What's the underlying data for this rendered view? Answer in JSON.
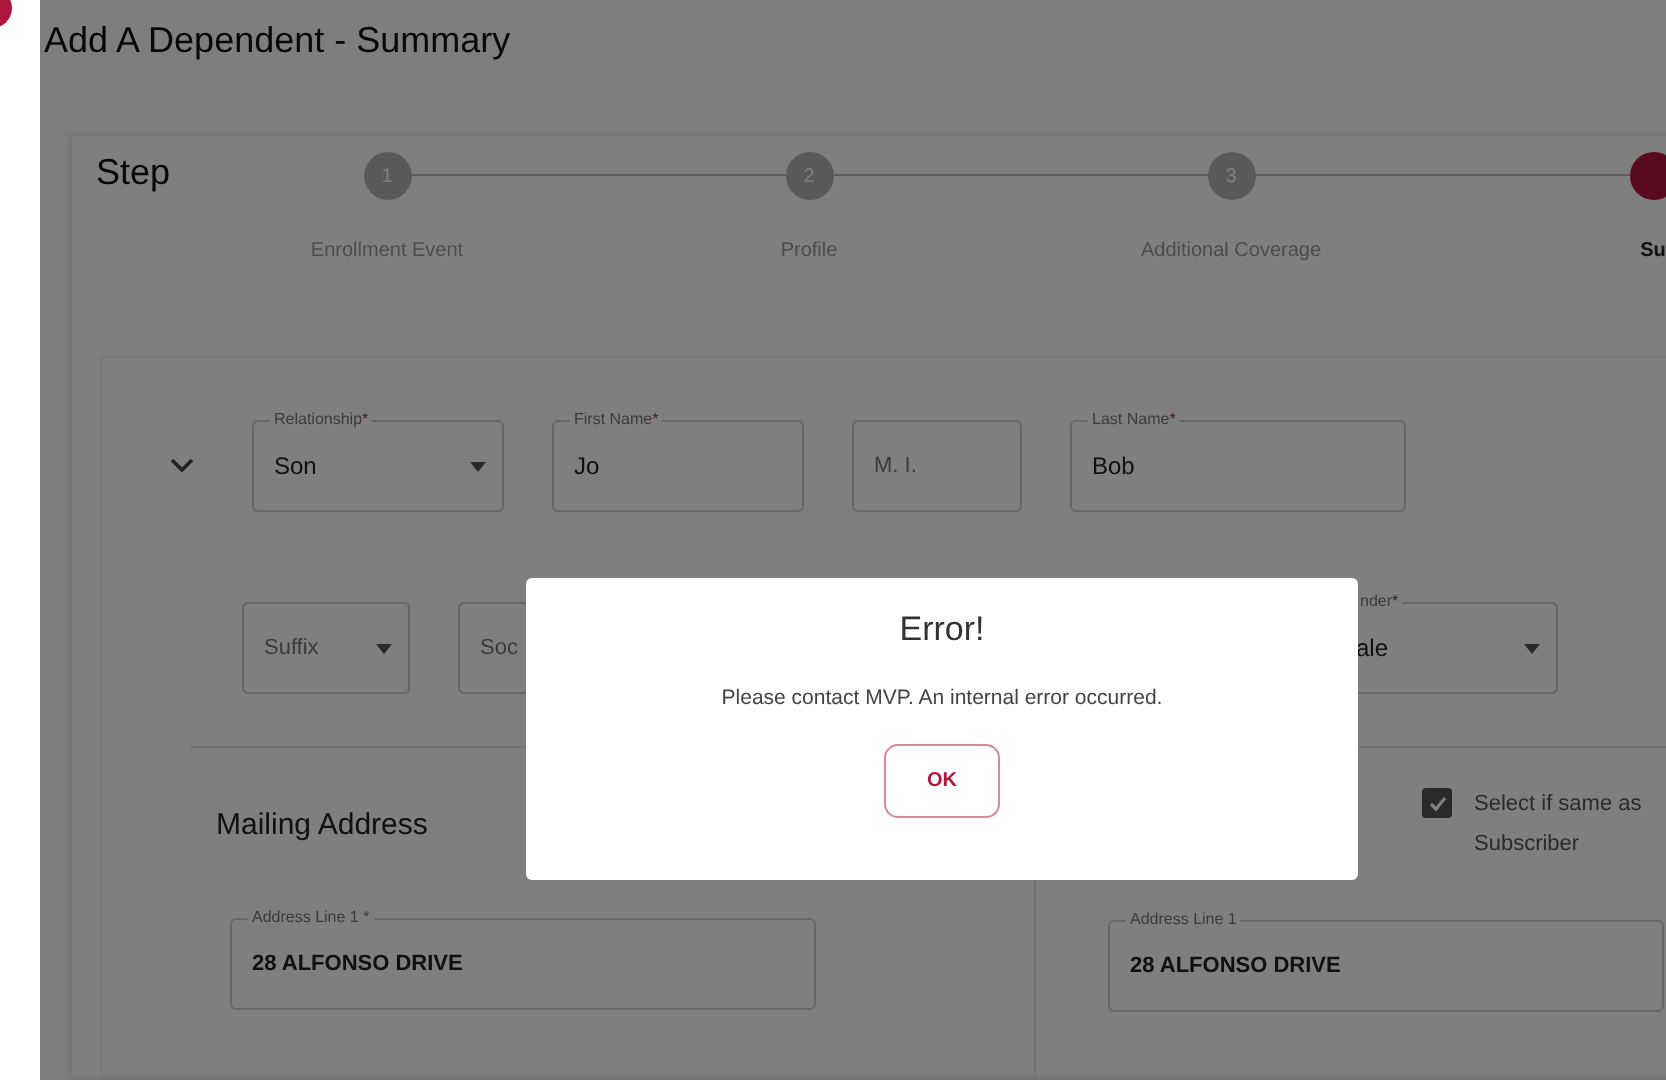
{
  "page_title": "Add A Dependent - Summary",
  "stepper": {
    "label": "Step",
    "steps": [
      {
        "number": "1",
        "label": "Enrollment Event",
        "selected": false
      },
      {
        "number": "2",
        "label": "Profile",
        "selected": false
      },
      {
        "number": "3",
        "label": "Additional Coverage",
        "selected": false
      },
      {
        "label": "Su",
        "selected": true
      }
    ]
  },
  "collapse_toggle": {
    "expanded": true
  },
  "row_1": [
    {
      "kind": "select",
      "label": "Relationship",
      "required_mark": "*",
      "value": "Son"
    },
    {
      "kind": "text",
      "label": "First Name",
      "required_mark": "*",
      "value": "Jo"
    },
    {
      "kind": "text",
      "placeholder": "M. I."
    },
    {
      "kind": "text",
      "label": "Last Name",
      "required_mark": "*",
      "value": "Bob"
    }
  ],
  "row_2": [
    {
      "kind": "select",
      "placeholder": "Suffix"
    },
    {
      "kind": "text",
      "placeholder": "Soc"
    },
    {
      "kind": "select",
      "label": "nder",
      "required_mark": "*",
      "value": "ale"
    }
  ],
  "mailing_address": {
    "title": "Mailing Address",
    "address_line_1": {
      "label": "Address Line 1 *",
      "value": "28 ALFONSO DRIVE"
    }
  },
  "same_as_subscriber": {
    "label": "Select if same as Subscriber",
    "checked": true,
    "address_line_1": {
      "label": "Address Line 1",
      "value": "28 ALFONSO DRIVE"
    }
  },
  "dialog": {
    "title": "Error!",
    "message": "Please contact MVP. An internal error occurred.",
    "button": "OK"
  }
}
